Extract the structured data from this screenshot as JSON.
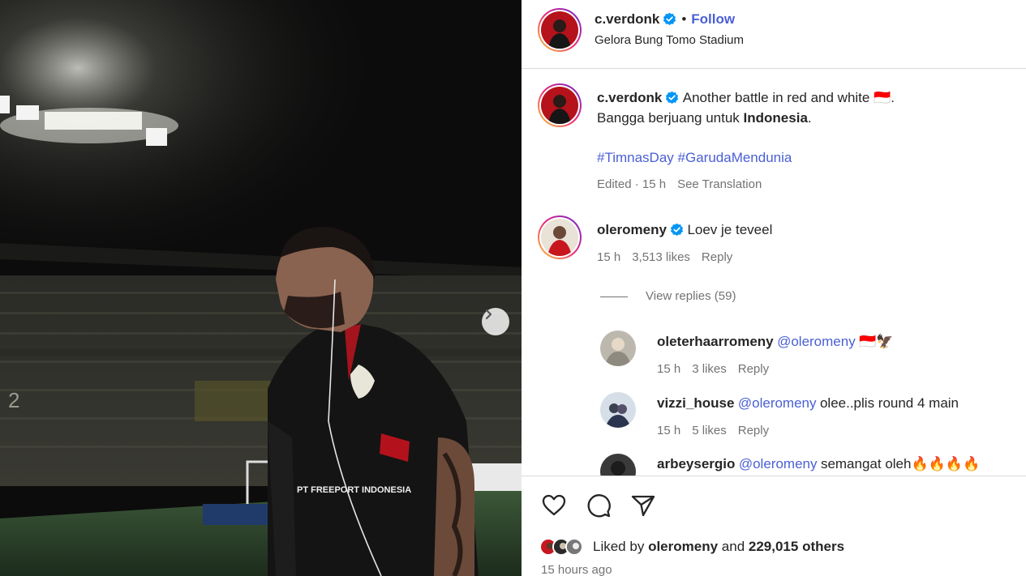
{
  "post": {
    "author": "c.verdonk",
    "follow_label": "Follow",
    "location": "Gelora Bung Tomo Stadium",
    "caption_line1": "Another battle in red and white 🇮🇩.",
    "caption_line2_prefix": "Bangga berjuang untuk",
    "caption_line2_bold": "Indonesia",
    "caption_line2_suffix": ".",
    "hashtag1": "#TimnasDay",
    "hashtag2": "#GarudaMendunia",
    "edited_time": "Edited · 15 h",
    "see_translation": "See Translation",
    "likes_prefix": "Liked by",
    "likes_user": "oleromeny",
    "likes_and": "and",
    "likes_count": "229,015 others",
    "posted_time": "15 hours ago"
  },
  "comments": [
    {
      "user": "oleromeny",
      "text": "Loev je teveel",
      "time": "15 h",
      "likes": "3,513 likes",
      "reply": "Reply"
    }
  ],
  "view_replies": "View replies (59)",
  "replies": [
    {
      "user": "oleterhaarromeny",
      "mention": "@oleromeny",
      "text": "🇮🇩🦅",
      "time": "15 h",
      "likes": "3 likes",
      "reply": "Reply"
    },
    {
      "user": "vizzi_house",
      "mention": "@oleromeny",
      "text": "olee..plis round 4 main",
      "time": "15 h",
      "likes": "5 likes",
      "reply": "Reply"
    },
    {
      "user": "arbeysergio",
      "mention": "@oleromeny",
      "text": "semangat oleh🔥🔥🔥🔥"
    }
  ],
  "icons": {
    "like": "heart-icon",
    "comment": "comment-icon",
    "share": "share-icon",
    "next": "chevron-right-icon",
    "verified": "verified-badge-icon"
  },
  "colors": {
    "link": "#4a5fd6",
    "verified": "#0095f6",
    "muted": "#737373"
  }
}
